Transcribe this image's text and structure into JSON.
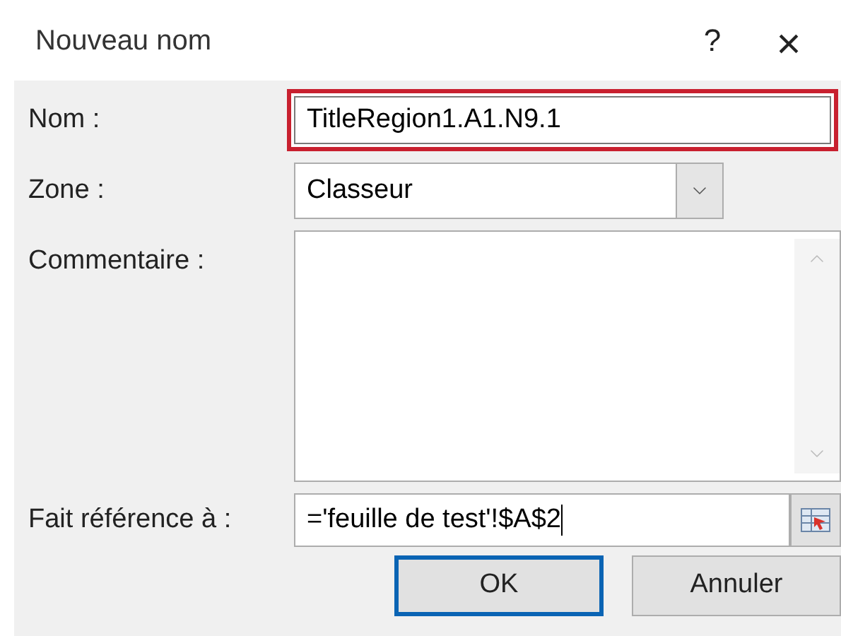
{
  "window": {
    "title": "Nouveau nom",
    "help": "?",
    "close": "×"
  },
  "fields": [
    {
      "kind": "text",
      "label": "Nom :",
      "value": "TitleRegion1.A1.N9.1",
      "highlighted": true
    },
    {
      "kind": "dropdown",
      "label": "Zone :",
      "value": "Classeur",
      "highlighted": false
    },
    {
      "kind": "textarea",
      "label": "Commentaire :",
      "highlighted": false
    },
    {
      "kind": "reference",
      "label": "Fait référence à :",
      "value": "='feuille de test'!$A$2",
      "highlighted": false
    }
  ],
  "buttons": [
    {
      "label": "OK",
      "default": true
    },
    {
      "label": "Annuler",
      "default": false
    }
  ]
}
